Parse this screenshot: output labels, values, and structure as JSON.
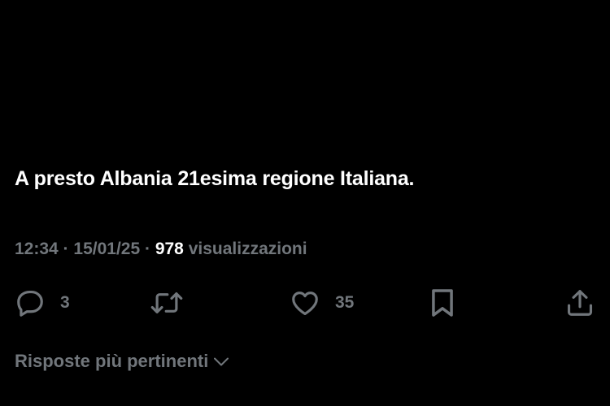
{
  "tweet": {
    "text": "A presto Albania 21esima regione Italiana.",
    "time": "12:34",
    "separator_1": " · ",
    "date": "15/01/25",
    "separator_2": " · ",
    "views_count": "978",
    "views_label": " visualizzazioni"
  },
  "actions": {
    "reply": {
      "icon": "reply-icon",
      "count": "3"
    },
    "retweet": {
      "icon": "retweet-icon"
    },
    "like": {
      "icon": "heart-icon",
      "count": "35"
    },
    "bookmark": {
      "icon": "bookmark-icon"
    },
    "share": {
      "icon": "share-icon"
    }
  },
  "replies_sort": {
    "label": "Risposte più pertinenti",
    "icon": "chevron-down-icon"
  },
  "colors": {
    "background": "#000000",
    "text_primary": "#ffffff",
    "text_secondary": "#71767b"
  }
}
